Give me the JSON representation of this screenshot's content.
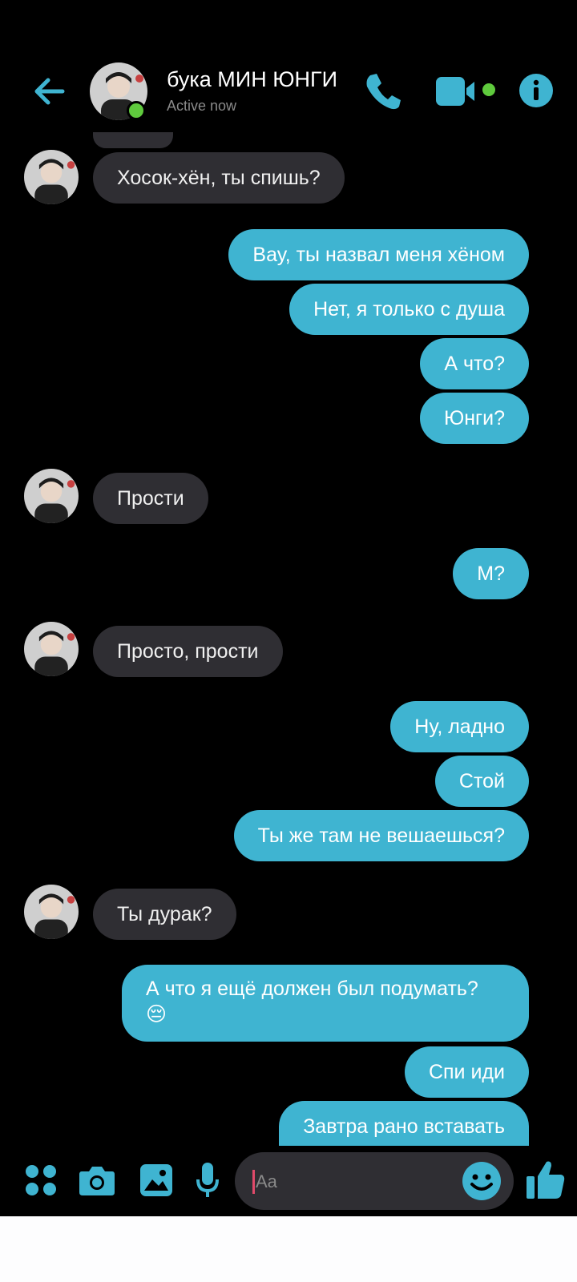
{
  "header": {
    "contact_name": "бука МИН ЮНГИ",
    "status": "Active now",
    "accent": "#3fb4d1",
    "online_color": "#5fca3d"
  },
  "messages": [
    {
      "side": "in",
      "text": "Хосок-хён, ты спишь?"
    },
    {
      "side": "out",
      "text": "Вау, ты назвал меня хёном"
    },
    {
      "side": "out",
      "text": "Нет, я только с душа"
    },
    {
      "side": "out",
      "text": "А что?"
    },
    {
      "side": "out",
      "text": "Юнги?"
    },
    {
      "side": "in",
      "text": "Прости"
    },
    {
      "side": "out",
      "text": "М?"
    },
    {
      "side": "in",
      "text": "Просто, прости"
    },
    {
      "side": "out",
      "text": "Ну, ладно"
    },
    {
      "side": "out",
      "text": "Стой"
    },
    {
      "side": "out",
      "text": "Ты же там не вешаешься?"
    },
    {
      "side": "in",
      "text": "Ты дурак?"
    },
    {
      "side": "out",
      "text": "А что я ещё должен был подумать?",
      "emoji": "😔"
    },
    {
      "side": "out",
      "text": "Спи иди"
    },
    {
      "side": "out",
      "text": "Завтра рано вставать"
    }
  ],
  "composer": {
    "placeholder": "Aa",
    "icons": [
      "apps-icon",
      "camera-icon",
      "gallery-icon",
      "microphone-icon",
      "emoji-icon",
      "thumbs-up-icon"
    ]
  }
}
